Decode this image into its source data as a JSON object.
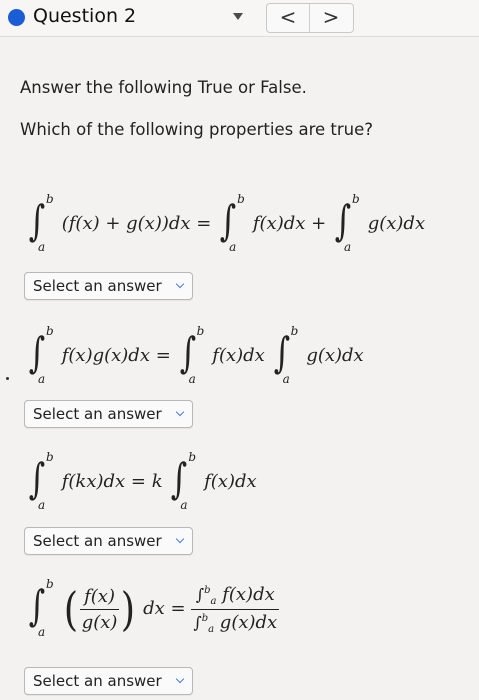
{
  "header": {
    "question_title": "Question 2",
    "prev_label": "<",
    "next_label": ">"
  },
  "instructions": {
    "line1": "Answer the following True or False.",
    "line2": "Which of the following properties are true?"
  },
  "properties": [
    {
      "lhs": "(f(x) + g(x))dx",
      "eq": "=",
      "rhs1": "f(x)dx",
      "plus": "+",
      "rhs2": "g(x)dx",
      "lower": "a",
      "upper": "b",
      "select": "Select an answer"
    },
    {
      "lhs": "f(x)g(x)dx",
      "eq": "=",
      "rhs1": "f(x)dx",
      "rhs2": "g(x)dx",
      "lower": "a",
      "upper": "b",
      "select": "Select an answer"
    },
    {
      "lhs": "f(kx)dx",
      "eq": "= k",
      "rhs1": "f(x)dx",
      "lower": "a",
      "upper": "b",
      "select": "Select an answer"
    },
    {
      "num": "f(x)",
      "den": "g(x)",
      "dx": "dx",
      "eq": "=",
      "rhs_num": "f(x)dx",
      "rhs_den": "g(x)dx",
      "lower": "a",
      "upper": "b",
      "select": "Select an answer"
    }
  ],
  "colors": {
    "accent": "#1a5dd6",
    "background": "#f3f2f1"
  },
  "icons": {
    "status": "question-status-dot",
    "dropdown": "chevron-down-icon"
  }
}
